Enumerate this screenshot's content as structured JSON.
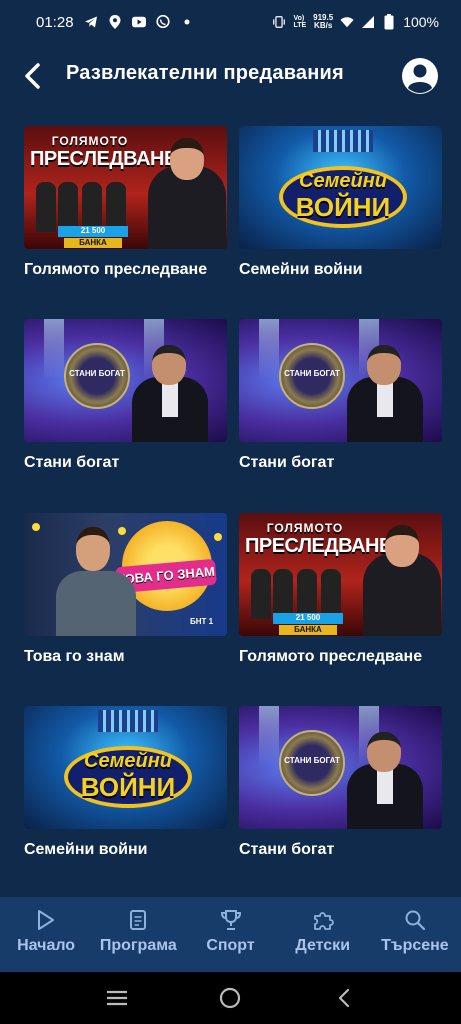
{
  "status_bar": {
    "time": "01:28",
    "speed_value": "919.5",
    "speed_unit": "KB/s",
    "volte": "Vo)",
    "lte": "LTE",
    "battery": "100%"
  },
  "header": {
    "title": "Развлекателни предавания"
  },
  "cards": [
    {
      "title": "Голямото преследване",
      "logo_l1": "ГОЛЯМОТО",
      "logo_l2": "ПРЕСЛЕДВАНЕ",
      "board": "21 500",
      "board2": "БАНКА"
    },
    {
      "title": "Семейни войни",
      "logo_l1": "Семейни",
      "logo_l2": "ВОЙНИ"
    },
    {
      "title": "Стани богат",
      "emblem": "СТАНИ БОГАТ"
    },
    {
      "title": "Стани богат",
      "emblem": "СТАНИ БОГАТ"
    },
    {
      "title": "Това го знам",
      "badge": "ТОВА ГО ЗНАМ",
      "channel": "БНТ 1"
    },
    {
      "title": "Голямото преследване",
      "logo_l1": "ГОЛЯМОТО",
      "logo_l2": "ПРЕСЛЕДВАНЕ",
      "board": "21 500",
      "board2": "БАНКА"
    },
    {
      "title": "Семейни войни",
      "logo_l1": "Семейни",
      "logo_l2": "ВОЙНИ"
    },
    {
      "title": "Стани богат",
      "emblem": "СТАНИ БОГАТ"
    }
  ],
  "bottom_nav": [
    {
      "label": "Начало",
      "icon": "play-icon"
    },
    {
      "label": "Програма",
      "icon": "schedule-icon"
    },
    {
      "label": "Спорт",
      "icon": "trophy-icon"
    },
    {
      "label": "Детски",
      "icon": "puzzle-icon"
    },
    {
      "label": "Търсене",
      "icon": "search-icon"
    }
  ],
  "colors": {
    "background": "#0f2a4a",
    "nav_background": "#183c6a",
    "nav_text": "#a9c4ea"
  }
}
